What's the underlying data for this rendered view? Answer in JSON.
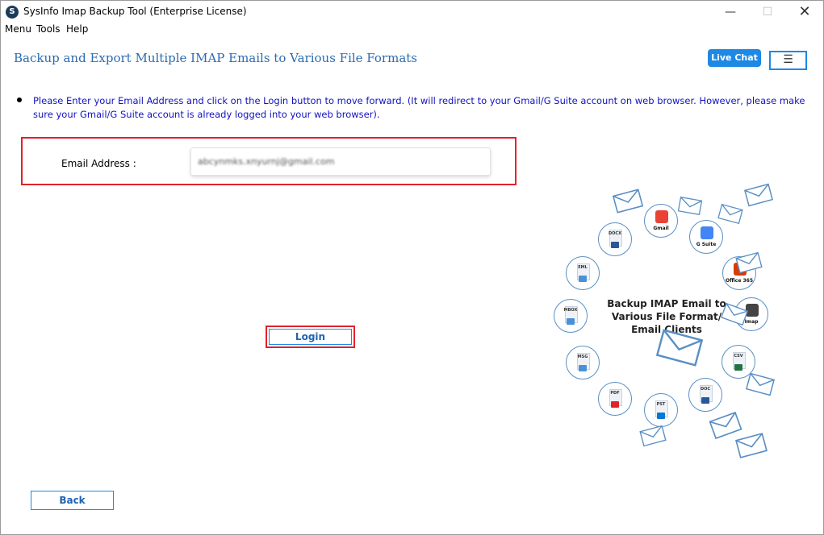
{
  "window": {
    "title": "SysInfo Imap Backup Tool (Enterprise License)",
    "app_icon_glyph": "S",
    "minimize_glyph": "—",
    "maximize_glyph": "☐",
    "close_glyph": "✕"
  },
  "menubar": {
    "menu": "Menu",
    "tools": "Tools",
    "help": "Help"
  },
  "header": {
    "title": "Backup and Export Multiple IMAP Emails to Various File Formats",
    "live_chat": "Live Chat",
    "hamburger_glyph": "☰"
  },
  "instruction": "Please Enter your Email Address and click on the Login button to move forward. (It will redirect to your Gmail/G Suite account on web browser. However, please make sure your Gmail/G Suite account is already logged into your web browser).",
  "form": {
    "email_label": "Email Address :",
    "email_value": "abcynmks.xnyurnj@gmail.com",
    "login_label": "Login",
    "back_label": "Back"
  },
  "graphic": {
    "center_text_line1": "Backup IMAP Email to",
    "center_text_line2": "Various File Format/",
    "center_text_line3": "Email Clients",
    "formats": [
      {
        "label": "DOCX",
        "icon": "word-icon",
        "color": "#2b5797"
      },
      {
        "label": "Gmail",
        "icon": "gmail-icon",
        "color": "#ea4335"
      },
      {
        "label": "G Suite",
        "icon": "gsuite-icon",
        "color": "#4285f4"
      },
      {
        "label": "Office 365",
        "icon": "office365-icon",
        "color": "#d83b01"
      },
      {
        "label": "Imap",
        "icon": "imap-icon",
        "color": "#444444"
      },
      {
        "label": "CSV",
        "icon": "excel-icon",
        "color": "#217346"
      },
      {
        "label": "DOC",
        "icon": "word-icon",
        "color": "#2b5797"
      },
      {
        "label": "PST",
        "icon": "outlook-icon",
        "color": "#0078d4"
      },
      {
        "label": "PDF",
        "icon": "pdf-icon",
        "color": "#e0232b"
      },
      {
        "label": "MSG",
        "icon": "mail-icon",
        "color": "#4a90d9"
      },
      {
        "label": "MBOX",
        "icon": "mbox-icon",
        "color": "#4a90d9"
      },
      {
        "label": "EML",
        "icon": "mail-icon",
        "color": "#4a90d9"
      }
    ]
  },
  "colors": {
    "accent": "#1e88e5",
    "highlight_red": "#e0232b",
    "instruction_blue": "#1212c0",
    "title_blue": "#2b6cb0"
  }
}
